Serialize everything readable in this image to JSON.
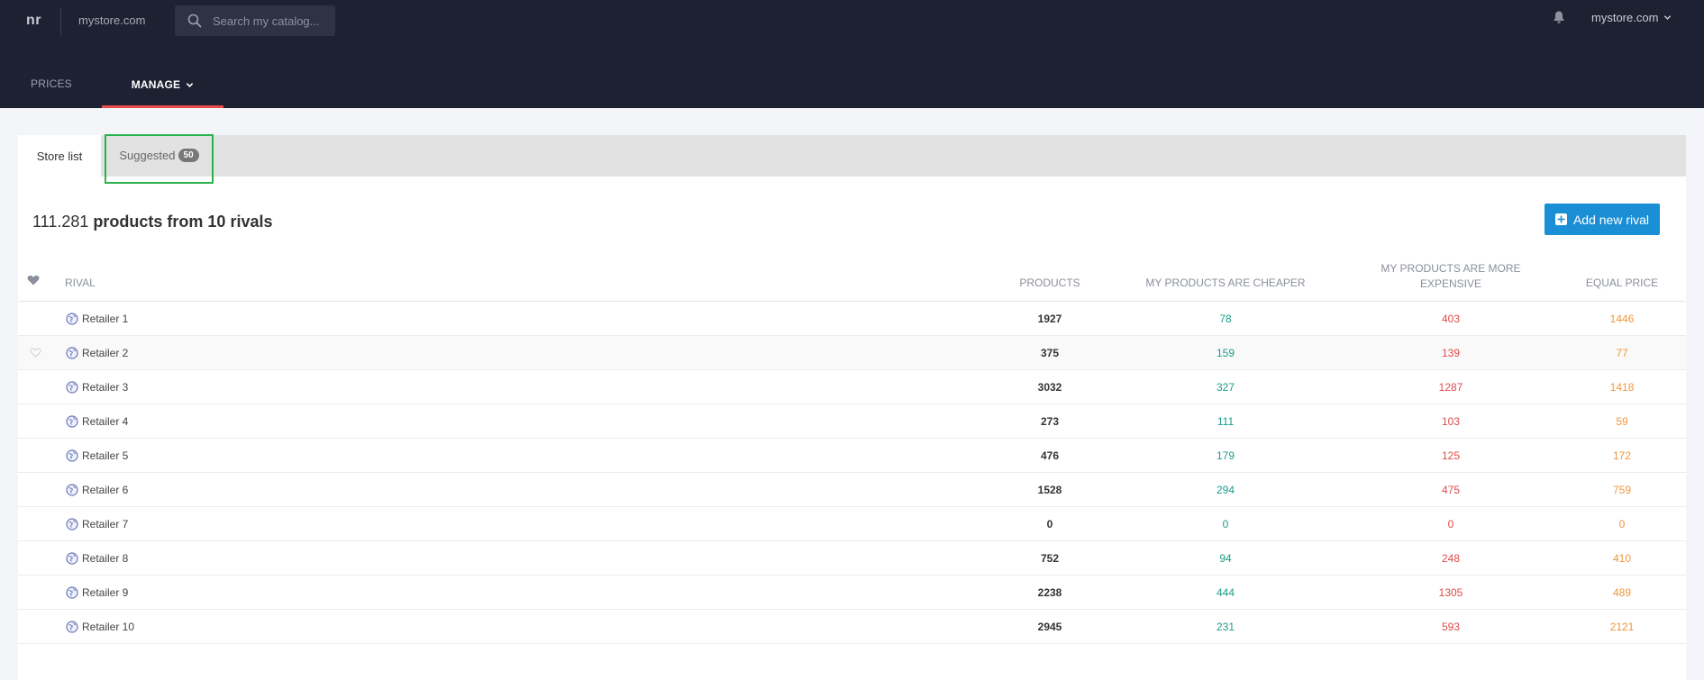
{
  "topbar": {
    "logo": "nr",
    "site": "mystore.com",
    "search_placeholder": "Search my catalog...",
    "account": "mystore.com"
  },
  "nav": {
    "prices": "PRICES",
    "manage": "MANAGE"
  },
  "tabs": {
    "store_list": "Store list",
    "suggested": "Suggested",
    "suggested_count": "50"
  },
  "summary": {
    "count": "111.281",
    "rest": "products from 10 rivals"
  },
  "add_button": "Add new rival",
  "table": {
    "headers": {
      "rival": "RIVAL",
      "products": "PRODUCTS",
      "cheaper": "MY PRODUCTS ARE CHEAPER",
      "expensive_line1": "MY PRODUCTS ARE MORE",
      "expensive_line2": "EXPENSIVE",
      "equal": "EQUAL PRICE"
    },
    "rows": [
      {
        "name": "Retailer 1",
        "products": "1927",
        "cheaper": "78",
        "expensive": "403",
        "equal": "1446"
      },
      {
        "name": "Retailer 2",
        "products": "375",
        "cheaper": "159",
        "expensive": "139",
        "equal": "77"
      },
      {
        "name": "Retailer 3",
        "products": "3032",
        "cheaper": "327",
        "expensive": "1287",
        "equal": "1418"
      },
      {
        "name": "Retailer 4",
        "products": "273",
        "cheaper": "111",
        "expensive": "103",
        "equal": "59"
      },
      {
        "name": "Retailer 5",
        "products": "476",
        "cheaper": "179",
        "expensive": "125",
        "equal": "172"
      },
      {
        "name": "Retailer 6",
        "products": "1528",
        "cheaper": "294",
        "expensive": "475",
        "equal": "759"
      },
      {
        "name": "Retailer 7",
        "products": "0",
        "cheaper": "0",
        "expensive": "0",
        "equal": "0"
      },
      {
        "name": "Retailer 8",
        "products": "752",
        "cheaper": "94",
        "expensive": "248",
        "equal": "410"
      },
      {
        "name": "Retailer 9",
        "products": "2238",
        "cheaper": "444",
        "expensive": "1305",
        "equal": "489"
      },
      {
        "name": "Retailer 10",
        "products": "2945",
        "cheaper": "231",
        "expensive": "593",
        "equal": "2121"
      }
    ]
  },
  "colors": {
    "topbar": "#1d2132",
    "accent_red": "#e94b4b",
    "button_blue": "#1a8fd6",
    "cheaper": "#1a9e8a",
    "expensive": "#e04a4a",
    "equal": "#f0963c",
    "suggested_highlight": "#2bb24c"
  }
}
